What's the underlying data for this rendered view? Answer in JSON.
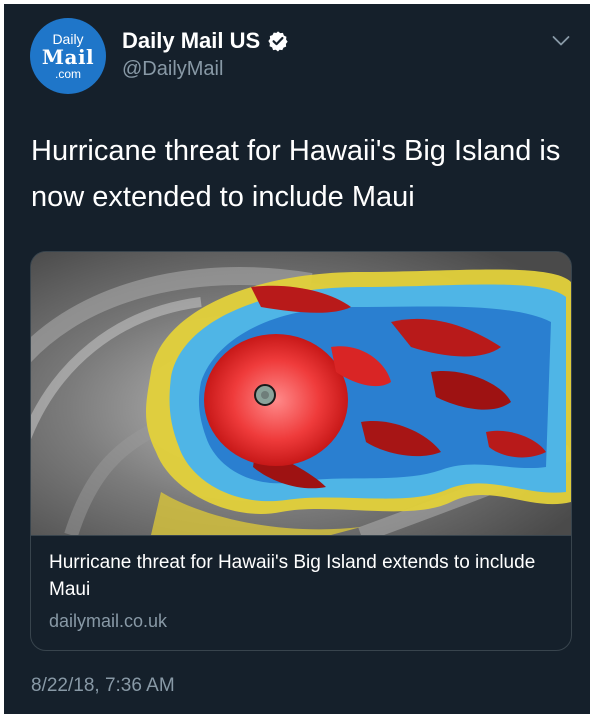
{
  "account": {
    "avatar_lines": [
      "Daily",
      "Mail",
      ".com"
    ],
    "display_name": "Daily Mail US",
    "handle": "@DailyMail",
    "verified": true
  },
  "tweet": {
    "text": "Hurricane threat for Hawaii's Big Island is now extended to include Maui",
    "timestamp": "8/22/18, 7:36 AM"
  },
  "card": {
    "image": "satellite-image of hurricane",
    "title": "Hurricane threat for Hawaii's Big Island extends to include Maui",
    "domain": "dailymail.co.uk"
  },
  "colors": {
    "background": "#15202b",
    "secondary_text": "#8899a6",
    "border": "#38444d",
    "avatar": "#1f76c9"
  },
  "icons": {
    "verified": "verified-badge-icon",
    "menu": "chevron-down-icon"
  }
}
